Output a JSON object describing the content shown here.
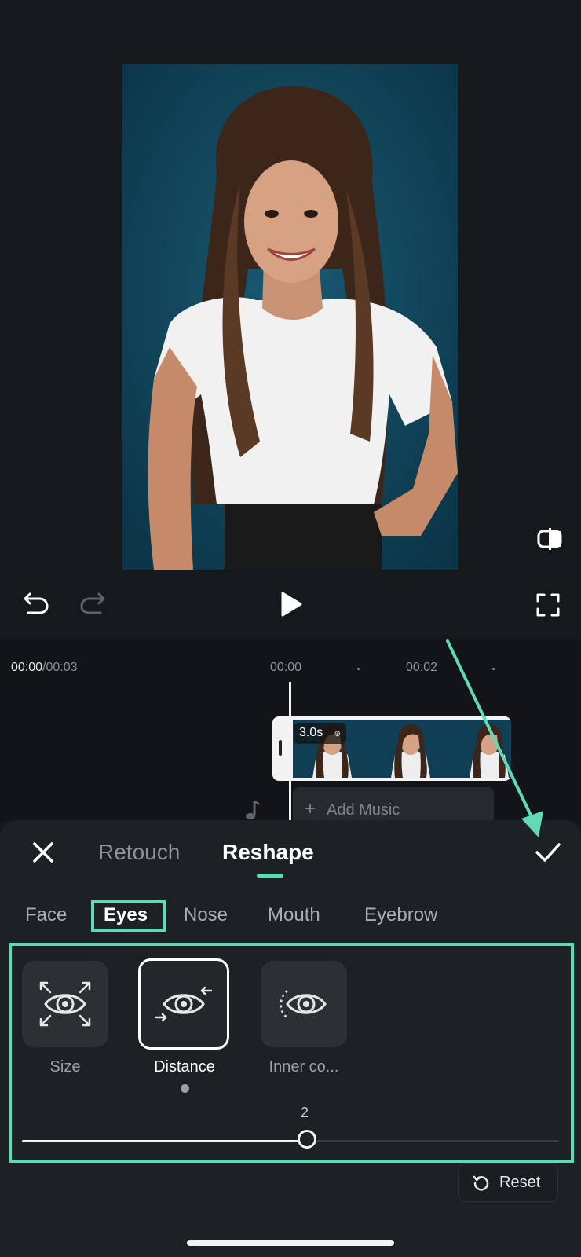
{
  "preview": {
    "photo_description": "portrait",
    "compare_icon": "compare-split-icon"
  },
  "playback": {
    "undo_icon": "undo-icon",
    "redo_icon": "redo-icon",
    "play_icon": "play-icon",
    "fullscreen_icon": "fullscreen-icon"
  },
  "timeline": {
    "current_time": "00:00",
    "total_time": "/00:03",
    "ruler_labels": [
      "00:00",
      "00:02"
    ],
    "clip_duration": "3.0s",
    "add_music_label": "Add Music"
  },
  "panel": {
    "tabs": [
      {
        "label": "Retouch",
        "active": false
      },
      {
        "label": "Reshape",
        "active": true
      }
    ],
    "subtabs": [
      {
        "label": "Face",
        "active": false
      },
      {
        "label": "Eyes",
        "active": true
      },
      {
        "label": "Nose",
        "active": false
      },
      {
        "label": "Mouth",
        "active": false
      },
      {
        "label": "Eyebrow",
        "active": false
      }
    ],
    "options": [
      {
        "label": "Size",
        "icon": "eye-size-icon",
        "selected": false
      },
      {
        "label": "Distance",
        "icon": "eye-distance-icon",
        "selected": true
      },
      {
        "label": "Inner co...",
        "icon": "eye-inner-corner-icon",
        "selected": false
      }
    ],
    "slider": {
      "value_label": "2",
      "fraction": 0.53
    },
    "reset_label": "Reset"
  },
  "colors": {
    "accent": "#5fd9b6",
    "background": "#16191c",
    "panel": "#1d2024"
  }
}
